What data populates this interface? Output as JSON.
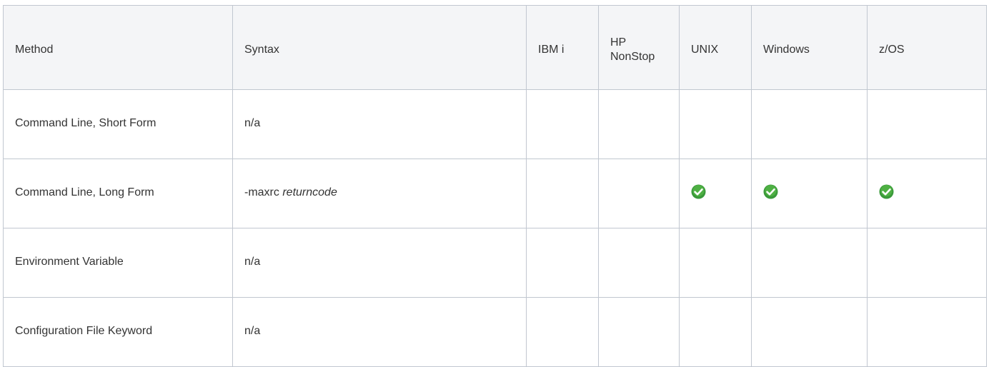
{
  "table": {
    "headers": [
      "Method",
      "Syntax",
      "IBM i",
      "HP NonStop",
      "UNIX",
      "Windows",
      "z/OS"
    ],
    "rows": [
      {
        "method": "Command Line, Short Form",
        "syntax_prefix": "n/a",
        "syntax_arg": "",
        "support": {
          "ibmi": false,
          "hpnonstop": false,
          "unix": false,
          "windows": false,
          "zos": false
        }
      },
      {
        "method": "Command Line, Long Form",
        "syntax_prefix": "-maxrc",
        "syntax_arg": "returncode",
        "support": {
          "ibmi": false,
          "hpnonstop": false,
          "unix": true,
          "windows": true,
          "zos": true
        }
      },
      {
        "method": "Environment Variable",
        "syntax_prefix": "n/a",
        "syntax_arg": "",
        "support": {
          "ibmi": false,
          "hpnonstop": false,
          "unix": false,
          "windows": false,
          "zos": false
        }
      },
      {
        "method": "Configuration File Keyword",
        "syntax_prefix": "n/a",
        "syntax_arg": "",
        "support": {
          "ibmi": false,
          "hpnonstop": false,
          "unix": false,
          "windows": false,
          "zos": false
        }
      }
    ],
    "support_icon": "check-circle-icon",
    "support_icon_color": "#3a9a3a",
    "header_bg": "#f4f5f7",
    "border_color": "#c1c7d0"
  }
}
